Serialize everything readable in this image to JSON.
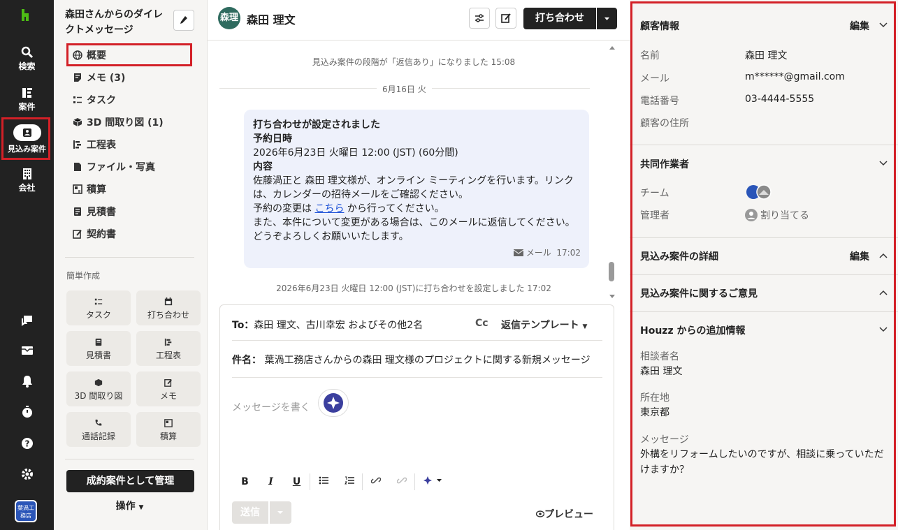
{
  "rail": {
    "items": [
      {
        "label": "検索",
        "icon": "search-icon"
      },
      {
        "label": "案件",
        "icon": "projects-icon"
      },
      {
        "label": "見込み案件",
        "icon": "leads-icon"
      },
      {
        "label": "会社",
        "icon": "building-icon"
      }
    ],
    "company_avatar": "葉渦工務店"
  },
  "nav": {
    "title": "森田さんからのダイレクトメッセージ",
    "items": [
      {
        "label": "概要",
        "icon": "globe-icon"
      },
      {
        "label": "メモ (3)",
        "icon": "memo-icon"
      },
      {
        "label": "タスク",
        "icon": "task-icon"
      },
      {
        "label": "3D 間取り図 (1)",
        "icon": "cube-icon"
      },
      {
        "label": "工程表",
        "icon": "schedule-icon"
      },
      {
        "label": "ファイル・写真",
        "icon": "file-icon"
      },
      {
        "label": "積算",
        "icon": "estimate-icon"
      },
      {
        "label": "見積書",
        "icon": "quote-icon"
      },
      {
        "label": "契約書",
        "icon": "contract-icon"
      }
    ],
    "quick_create_label": "簡単作成",
    "quick_create": [
      {
        "label": "タスク"
      },
      {
        "label": "打ち合わせ"
      },
      {
        "label": "見積書"
      },
      {
        "label": "工程表"
      },
      {
        "label": "3D 間取り図"
      },
      {
        "label": "メモ"
      },
      {
        "label": "通話記録"
      },
      {
        "label": "積算"
      }
    ],
    "won_button": "成約案件として管理",
    "ops_button": "操作"
  },
  "header": {
    "avatar_initials": "森理",
    "name": "森田 理文",
    "meeting_button": "打ち合わせ"
  },
  "feed": {
    "status_change": "見込み案件の段階が「返信あり」になりました 15:08",
    "date_divider": "6月16日 火",
    "message": {
      "title": "打ち合わせが設定されました",
      "heading_date": "予約日時",
      "datetime": "2026年6月23日 火曜日 12:00 (JST) (60分間)",
      "heading_content": "内容",
      "body1": "佐藤渦正と 森田 理文様が、オンライン ミーティングを行います。リンクは、カレンダーの招待メールをご確認ください。",
      "body2_pre": "予約の変更は ",
      "body2_link": "こちら",
      "body2_post": " から行ってください。",
      "body3": "また、本件について変更がある場合は、このメールに返信してください。",
      "body4": "どうぞよろしくお願いいたします。",
      "meta_channel": "メール",
      "meta_time": "17:02"
    },
    "meeting_set": "2026年6月23日 火曜日 12:00 (JST)に打ち合わせを設定しました 17:02"
  },
  "compose": {
    "to_label": "To：",
    "to_value": "森田 理文、古川幸宏 およびその他2名",
    "cc": "Cc",
    "template": "返信テンプレート",
    "subject_label": "件名：",
    "subject_value": "葉渦工務店さんからの森田 理文様のプロジェクトに関する新規メッセージ",
    "placeholder": "メッセージを書く",
    "send": "送信",
    "preview": "プレビュー"
  },
  "right": {
    "customer": {
      "title": "顧客情報",
      "edit": "編集",
      "name_label": "名前",
      "name_value": "森田 理文",
      "email_label": "メール",
      "email_value": "m******@gmail.com",
      "phone_label": "電話番号",
      "phone_value": "03-4444-5555",
      "address_label": "顧客の住所"
    },
    "collab": {
      "title": "共同作業者",
      "team_label": "チーム",
      "manager_label": "管理者",
      "assign": "割り当てる"
    },
    "lead_detail": {
      "title": "見込み案件の詳細",
      "edit": "編集"
    },
    "feedback": {
      "title": "見込み案件に関するご意見"
    },
    "houzz": {
      "title": "Houzz からの追加情報",
      "consultant_label": "相談者名",
      "consultant_value": "森田 理文",
      "location_label": "所在地",
      "location_value": "東京都",
      "message_label": "メッセージ",
      "message_value": "外構をリフォームしたいのですが、相談に乗っていただけますか？"
    }
  },
  "colors": {
    "rail": "#222222",
    "highlight": "#d32027",
    "bubble": "#eef1fb",
    "accent": "#1a4fd6"
  }
}
